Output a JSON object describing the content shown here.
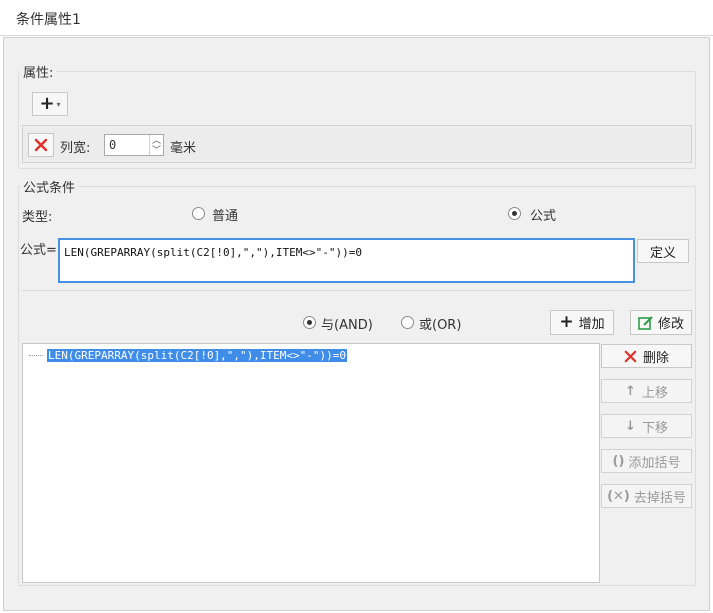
{
  "window": {
    "title": "条件属性1"
  },
  "property_group": {
    "legend": "属性:",
    "add_icon": "plus-icon",
    "row": {
      "delete_icon": "red-x-icon",
      "label": "列宽:",
      "value": "0",
      "unit": "毫米"
    }
  },
  "formula_group": {
    "legend": "公式条件",
    "type_label": "类型:",
    "type_options": [
      {
        "label": "普通",
        "checked": false
      },
      {
        "label": "公式",
        "checked": true
      }
    ],
    "formula_label": "公式=",
    "formula_value": "LEN(GREPARRAY(split(C2[!0],\",\"),ITEM<>\"-\"))=0",
    "define_button": "定义",
    "logic_options": [
      {
        "label": "与(AND)",
        "checked": true
      },
      {
        "label": "或(OR)",
        "checked": false
      }
    ],
    "add_button": "增加",
    "modify_button": "修改",
    "condition_items": [
      "LEN(GREPARRAY(split(C2[!0],\",\"),ITEM<>\"-\"))=0"
    ],
    "side_buttons": {
      "delete": "删除",
      "move_up": "上移",
      "move_down": "下移",
      "add_bracket": "添加括号",
      "remove_bracket": "去掉括号"
    }
  },
  "colors": {
    "accent": "#4a90e2",
    "selection": "#3f8de8",
    "delete_red": "#e0302a",
    "modify_green": "#2e9b4a"
  }
}
